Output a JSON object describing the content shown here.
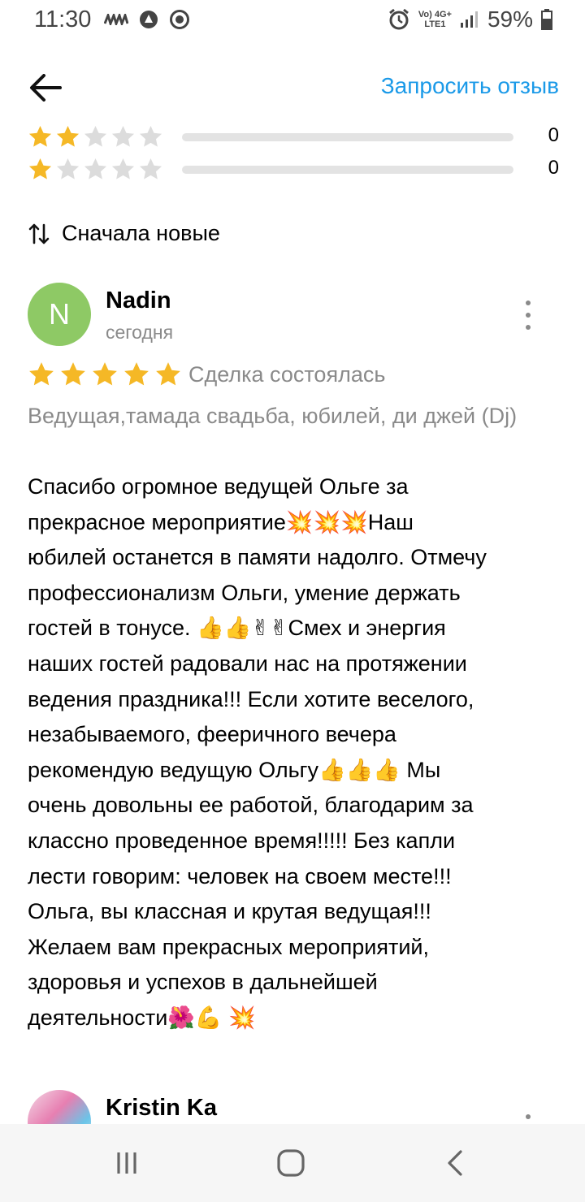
{
  "status_bar": {
    "time": "11:30",
    "battery": "59%",
    "network_top": "Vo) 4G+",
    "network_bottom": "LTE1",
    "icons": [
      "carrier-icon",
      "sync-icon",
      "record-icon",
      "alarm-icon",
      "signal-icon",
      "battery-icon"
    ]
  },
  "header": {
    "back_icon": "arrow-left-icon",
    "request_review": "Запросить отзыв"
  },
  "rating_distribution": [
    {
      "stars": 2,
      "count": "0",
      "fill_fraction": 0
    },
    {
      "stars": 1,
      "count": "0",
      "fill_fraction": 0
    }
  ],
  "sort": {
    "icon": "sort-arrows-icon",
    "label": "Сначала новые"
  },
  "review": {
    "avatar_letter": "N",
    "author": "Nadin",
    "date": "сегодня",
    "rating": 5,
    "deal_status": "Сделка состоялась",
    "service": "Ведущая,тамада свадьба, юбилей, ди джей (Dj)",
    "text": "Спасибо огромное ведущей Ольге за\nпрекрасное мероприятие💥💥💥Наш\nюбилей останется в памяти надолго. Отмечу\nпрофессионализм  Ольги, умение держать\nгостей в тонусе. 👍👍✌✌Смех и энергия\nнаших гостей радовали нас на протяжении\nведения праздника!!! Если хотите веселого,\nнезабываемого, фееричного вечера\nрекомендую ведущую Ольгу👍👍👍 Мы\nочень довольны ее работой, благодарим за\nклассно проведенное время!!!!! Без капли\nлести говорим: человек на своем месте!!!\nОльга, вы классная и крутая ведущая!!!\nЖелаем вам прекрасных мероприятий,\nздоровья и успехов в дальнейшей\nдеятельности🌺💪 💥"
  },
  "review2": {
    "author": "Kristin Ka"
  },
  "colors": {
    "accent": "#1b9ae8",
    "star_filled": "#f5b826",
    "star_empty": "#dcdcdc",
    "avatar_bg": "#8ec965",
    "secondary_text": "#8a8a8a"
  },
  "nav_bar": {
    "icons": [
      "recent-apps-icon",
      "home-icon",
      "back-nav-icon"
    ]
  }
}
